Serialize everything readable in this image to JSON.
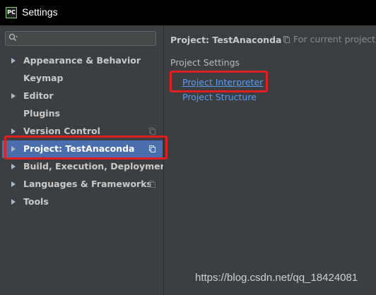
{
  "window": {
    "app_icon_text": "PC",
    "title": "Settings"
  },
  "search": {
    "placeholder": "",
    "value": ""
  },
  "sidebar": {
    "items": [
      {
        "label": "Appearance & Behavior",
        "expandable": true,
        "has_copy_icon": false,
        "selected": false
      },
      {
        "label": "Keymap",
        "expandable": false,
        "has_copy_icon": false,
        "selected": false
      },
      {
        "label": "Editor",
        "expandable": true,
        "has_copy_icon": false,
        "selected": false
      },
      {
        "label": "Plugins",
        "expandable": false,
        "has_copy_icon": false,
        "selected": false
      },
      {
        "label": "Version Control",
        "expandable": true,
        "has_copy_icon": true,
        "selected": false
      },
      {
        "label": "Project: TestAnaconda",
        "expandable": true,
        "has_copy_icon": true,
        "selected": true
      },
      {
        "label": "Build, Execution, Deployment",
        "expandable": true,
        "has_copy_icon": false,
        "selected": false
      },
      {
        "label": "Languages & Frameworks",
        "expandable": true,
        "has_copy_icon": true,
        "selected": false
      },
      {
        "label": "Tools",
        "expandable": true,
        "has_copy_icon": false,
        "selected": false
      }
    ]
  },
  "main": {
    "title": "Project: TestAnaconda",
    "scope_label": "For current project",
    "section_title": "Project Settings",
    "links": [
      {
        "label": "Project Interpreter",
        "underlined": true
      },
      {
        "label": "Project Structure",
        "underlined": false
      }
    ]
  },
  "watermark": "https://blog.csdn.net/qq_18424081",
  "colors": {
    "panel_bg": "#3c3f41",
    "selection_bg": "#4b6eaf",
    "link": "#589df6",
    "annotation": "#e02020"
  }
}
